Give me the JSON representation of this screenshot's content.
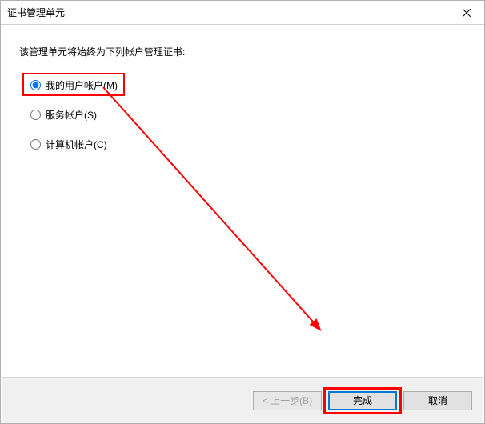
{
  "titlebar": {
    "title": "证书管理单元"
  },
  "content": {
    "prompt": "该管理单元将始终为下列帐户管理证书:",
    "options": {
      "my_user": "我的用户帐户(M)",
      "service": "服务帐户(S)",
      "computer": "计算机帐户(C)"
    }
  },
  "buttons": {
    "back": "< 上一步(B)",
    "finish": "完成",
    "cancel": "取消"
  }
}
